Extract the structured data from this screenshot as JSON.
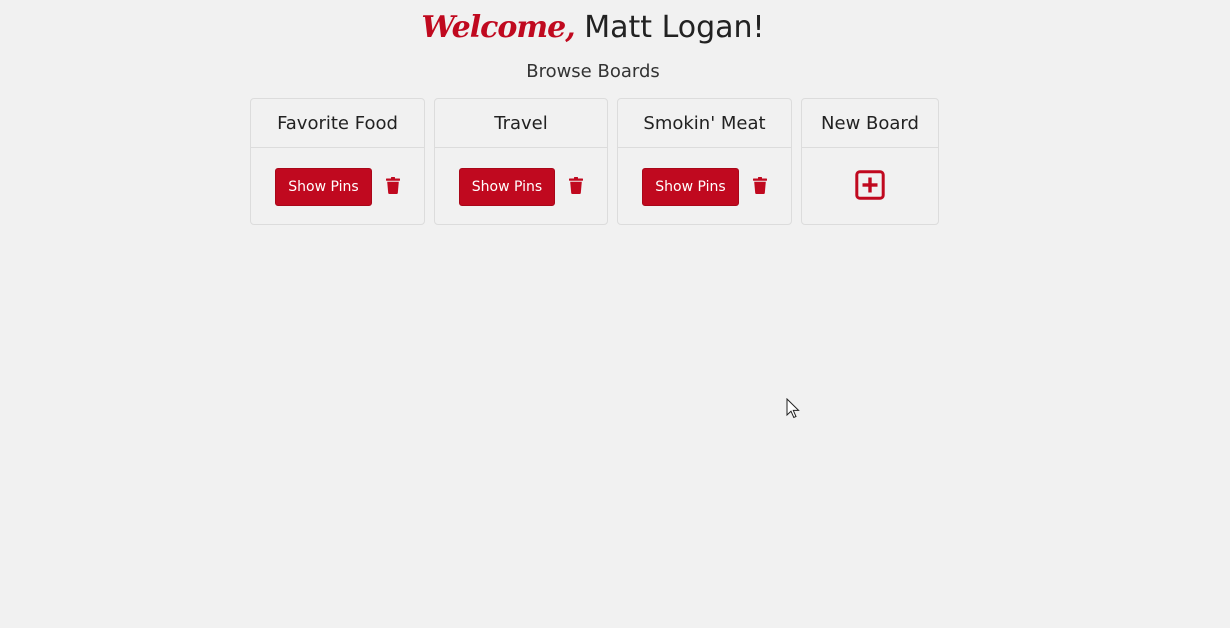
{
  "header": {
    "welcome_word": "Welcome,",
    "user_name": "Matt Logan!",
    "subtitle": "Browse Boards"
  },
  "boards": [
    {
      "title": "Favorite Food",
      "button_label": "Show Pins",
      "delete_icon": "trash-icon"
    },
    {
      "title": "Travel",
      "button_label": "Show Pins",
      "delete_icon": "trash-icon"
    },
    {
      "title": "Smokin' Meat",
      "button_label": "Show Pins",
      "delete_icon": "trash-icon"
    }
  ],
  "new_board": {
    "title": "New Board",
    "icon": "plus-square-icon"
  },
  "colors": {
    "accent": "#c0091f",
    "background": "#f1f1f1",
    "border": "#dcdcdc"
  }
}
